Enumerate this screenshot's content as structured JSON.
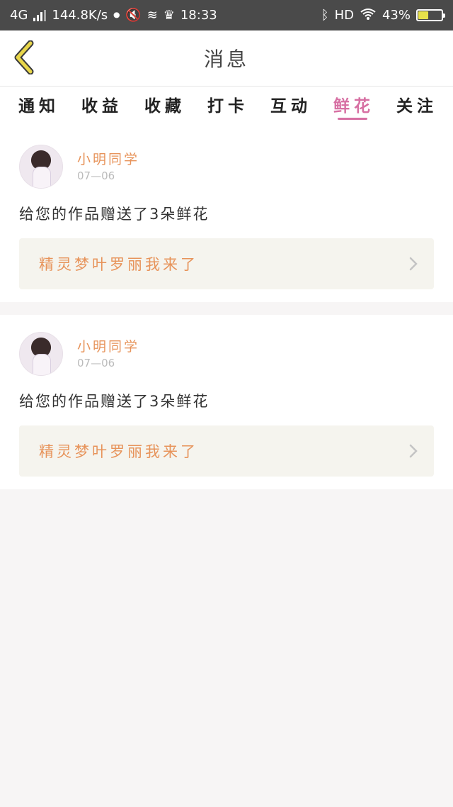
{
  "status_bar": {
    "network": "4G",
    "speed": "144.8K/s",
    "time": "18:33",
    "hd": "HD",
    "battery": "43%",
    "battery_level": 0.43
  },
  "header": {
    "title": "消息"
  },
  "tabs": [
    {
      "label": "通知",
      "active": false
    },
    {
      "label": "收益",
      "active": false
    },
    {
      "label": "收藏",
      "active": false
    },
    {
      "label": "打卡",
      "active": false
    },
    {
      "label": "互动",
      "active": false
    },
    {
      "label": "鲜花",
      "active": true
    },
    {
      "label": "关注",
      "active": false
    }
  ],
  "messages": [
    {
      "username": "小明同学",
      "date": "07—06",
      "text": "给您的作品赠送了3朵鲜花",
      "work_title": "精灵梦叶罗丽我来了"
    },
    {
      "username": "小明同学",
      "date": "07—06",
      "text": "给您的作品赠送了3朵鲜花",
      "work_title": "精灵梦叶罗丽我来了"
    }
  ],
  "colors": {
    "accent": "#d770a3",
    "username": "#e7935a",
    "back_icon": "#e8d64a"
  }
}
